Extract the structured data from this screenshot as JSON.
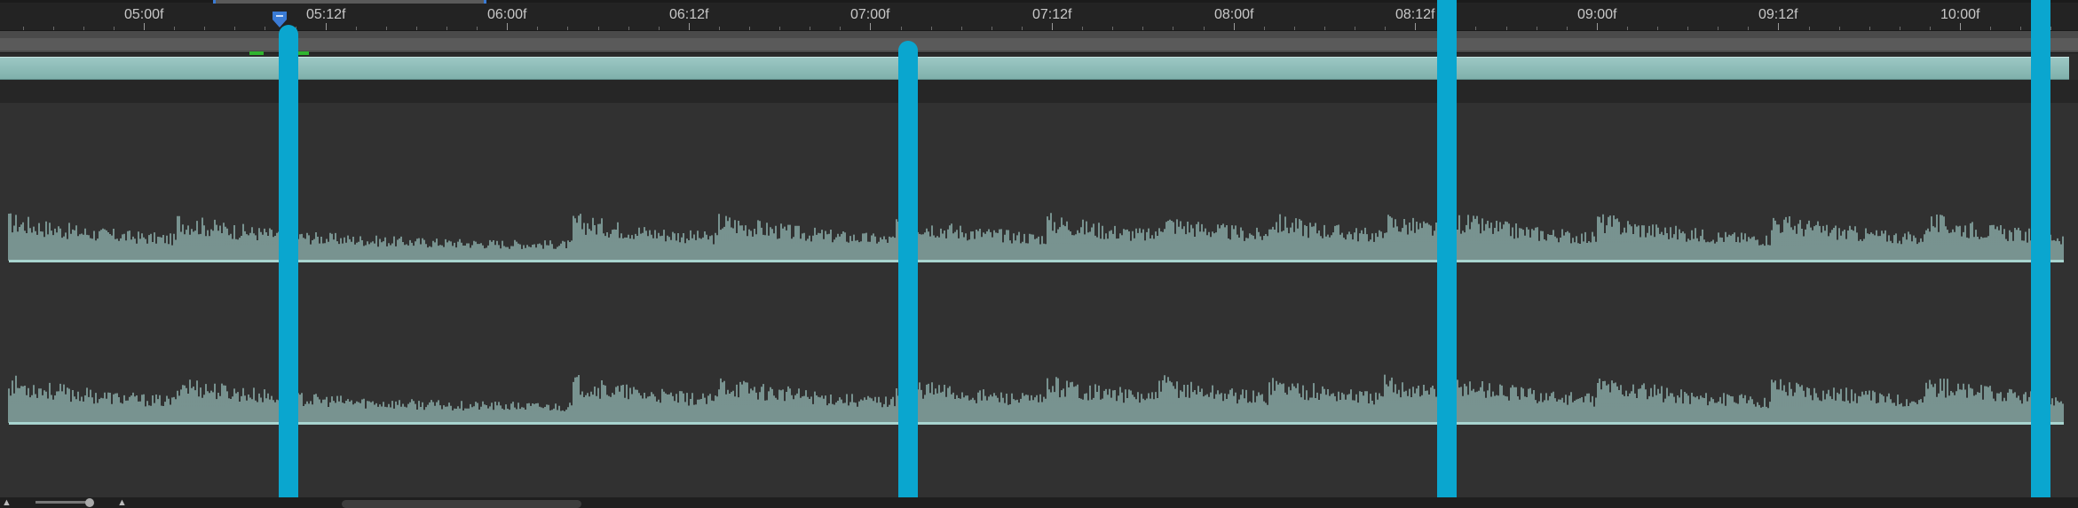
{
  "timeline": {
    "ruler": {
      "ticks": [
        {
          "label": "05:00f"
        },
        {
          "label": "05:12f"
        },
        {
          "label": "06:00f"
        },
        {
          "label": "06:12f"
        },
        {
          "label": "07:00f"
        },
        {
          "label": "07:12f"
        },
        {
          "label": "08:00f"
        },
        {
          "label": "08:12f"
        },
        {
          "label": "09:00f"
        },
        {
          "label": "09:12f"
        },
        {
          "label": "10:00f"
        }
      ]
    },
    "playhead_icon": "playhead-marker-icon",
    "markers": {
      "color": "#0aa6cf",
      "items": [
        {
          "name": "marker-1"
        },
        {
          "name": "marker-2"
        },
        {
          "name": "marker-3"
        },
        {
          "name": "marker-4"
        }
      ]
    },
    "audio": {
      "waveform_color": "#a8d4cf",
      "channels": [
        {
          "name": "channel-left"
        },
        {
          "name": "channel-right"
        }
      ]
    },
    "bottom_controls": {
      "zoom_out_icon": "mountain-small-icon",
      "zoom_in_icon": "mountain-large-icon"
    },
    "colors": {
      "background": "#2b2b2b",
      "clip": "#9cc7c4",
      "cache": "#2fb52f",
      "playhead": "#3a7bd5"
    }
  }
}
